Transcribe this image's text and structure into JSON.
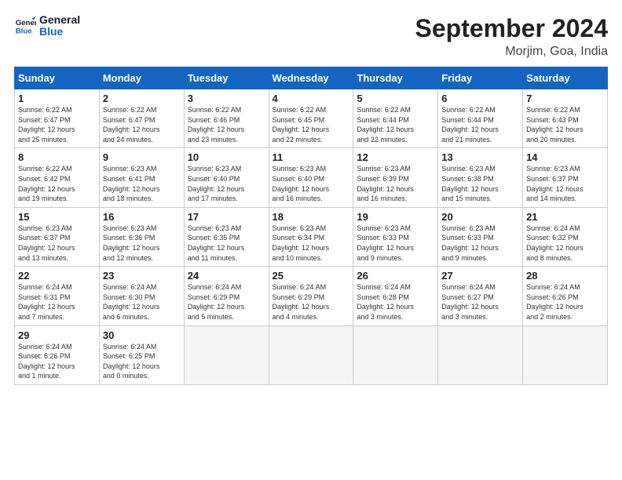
{
  "logo": {
    "line1": "General",
    "line2": "Blue"
  },
  "title": "September 2024",
  "location": "Morjim, Goa, India",
  "days_of_week": [
    "Sunday",
    "Monday",
    "Tuesday",
    "Wednesday",
    "Thursday",
    "Friday",
    "Saturday"
  ],
  "weeks": [
    [
      {
        "day": "1",
        "info": "Sunrise: 6:22 AM\nSunset: 6:47 PM\nDaylight: 12 hours\nand 25 minutes."
      },
      {
        "day": "2",
        "info": "Sunrise: 6:22 AM\nSunset: 6:47 PM\nDaylight: 12 hours\nand 24 minutes."
      },
      {
        "day": "3",
        "info": "Sunrise: 6:22 AM\nSunset: 6:46 PM\nDaylight: 12 hours\nand 23 minutes."
      },
      {
        "day": "4",
        "info": "Sunrise: 6:22 AM\nSunset: 6:45 PM\nDaylight: 12 hours\nand 22 minutes."
      },
      {
        "day": "5",
        "info": "Sunrise: 6:22 AM\nSunset: 6:44 PM\nDaylight: 12 hours\nand 22 minutes."
      },
      {
        "day": "6",
        "info": "Sunrise: 6:22 AM\nSunset: 6:44 PM\nDaylight: 12 hours\nand 21 minutes."
      },
      {
        "day": "7",
        "info": "Sunrise: 6:22 AM\nSunset: 6:43 PM\nDaylight: 12 hours\nand 20 minutes."
      }
    ],
    [
      {
        "day": "8",
        "info": "Sunrise: 6:22 AM\nSunset: 6:42 PM\nDaylight: 12 hours\nand 19 minutes."
      },
      {
        "day": "9",
        "info": "Sunrise: 6:23 AM\nSunset: 6:41 PM\nDaylight: 12 hours\nand 18 minutes."
      },
      {
        "day": "10",
        "info": "Sunrise: 6:23 AM\nSunset: 6:40 PM\nDaylight: 12 hours\nand 17 minutes."
      },
      {
        "day": "11",
        "info": "Sunrise: 6:23 AM\nSunset: 6:40 PM\nDaylight: 12 hours\nand 16 minutes."
      },
      {
        "day": "12",
        "info": "Sunrise: 6:23 AM\nSunset: 6:39 PM\nDaylight: 12 hours\nand 16 minutes."
      },
      {
        "day": "13",
        "info": "Sunrise: 6:23 AM\nSunset: 6:38 PM\nDaylight: 12 hours\nand 15 minutes."
      },
      {
        "day": "14",
        "info": "Sunrise: 6:23 AM\nSunset: 6:37 PM\nDaylight: 12 hours\nand 14 minutes."
      }
    ],
    [
      {
        "day": "15",
        "info": "Sunrise: 6:23 AM\nSunset: 6:37 PM\nDaylight: 12 hours\nand 13 minutes."
      },
      {
        "day": "16",
        "info": "Sunrise: 6:23 AM\nSunset: 6:36 PM\nDaylight: 12 hours\nand 12 minutes."
      },
      {
        "day": "17",
        "info": "Sunrise: 6:23 AM\nSunset: 6:35 PM\nDaylight: 12 hours\nand 11 minutes."
      },
      {
        "day": "18",
        "info": "Sunrise: 6:23 AM\nSunset: 6:34 PM\nDaylight: 12 hours\nand 10 minutes."
      },
      {
        "day": "19",
        "info": "Sunrise: 6:23 AM\nSunset: 6:33 PM\nDaylight: 12 hours\nand 9 minutes."
      },
      {
        "day": "20",
        "info": "Sunrise: 6:23 AM\nSunset: 6:33 PM\nDaylight: 12 hours\nand 9 minutes."
      },
      {
        "day": "21",
        "info": "Sunrise: 6:24 AM\nSunset: 6:32 PM\nDaylight: 12 hours\nand 8 minutes."
      }
    ],
    [
      {
        "day": "22",
        "info": "Sunrise: 6:24 AM\nSunset: 6:31 PM\nDaylight: 12 hours\nand 7 minutes."
      },
      {
        "day": "23",
        "info": "Sunrise: 6:24 AM\nSunset: 6:30 PM\nDaylight: 12 hours\nand 6 minutes."
      },
      {
        "day": "24",
        "info": "Sunrise: 6:24 AM\nSunset: 6:29 PM\nDaylight: 12 hours\nand 5 minutes."
      },
      {
        "day": "25",
        "info": "Sunrise: 6:24 AM\nSunset: 6:29 PM\nDaylight: 12 hours\nand 4 minutes."
      },
      {
        "day": "26",
        "info": "Sunrise: 6:24 AM\nSunset: 6:28 PM\nDaylight: 12 hours\nand 3 minutes."
      },
      {
        "day": "27",
        "info": "Sunrise: 6:24 AM\nSunset: 6:27 PM\nDaylight: 12 hours\nand 3 minutes."
      },
      {
        "day": "28",
        "info": "Sunrise: 6:24 AM\nSunset: 6:26 PM\nDaylight: 12 hours\nand 2 minutes."
      }
    ],
    [
      {
        "day": "29",
        "info": "Sunrise: 6:24 AM\nSunset: 6:26 PM\nDaylight: 12 hours\nand 1 minute."
      },
      {
        "day": "30",
        "info": "Sunrise: 6:24 AM\nSunset: 6:25 PM\nDaylight: 12 hours\nand 0 minutes."
      },
      {
        "day": "",
        "info": ""
      },
      {
        "day": "",
        "info": ""
      },
      {
        "day": "",
        "info": ""
      },
      {
        "day": "",
        "info": ""
      },
      {
        "day": "",
        "info": ""
      }
    ]
  ]
}
